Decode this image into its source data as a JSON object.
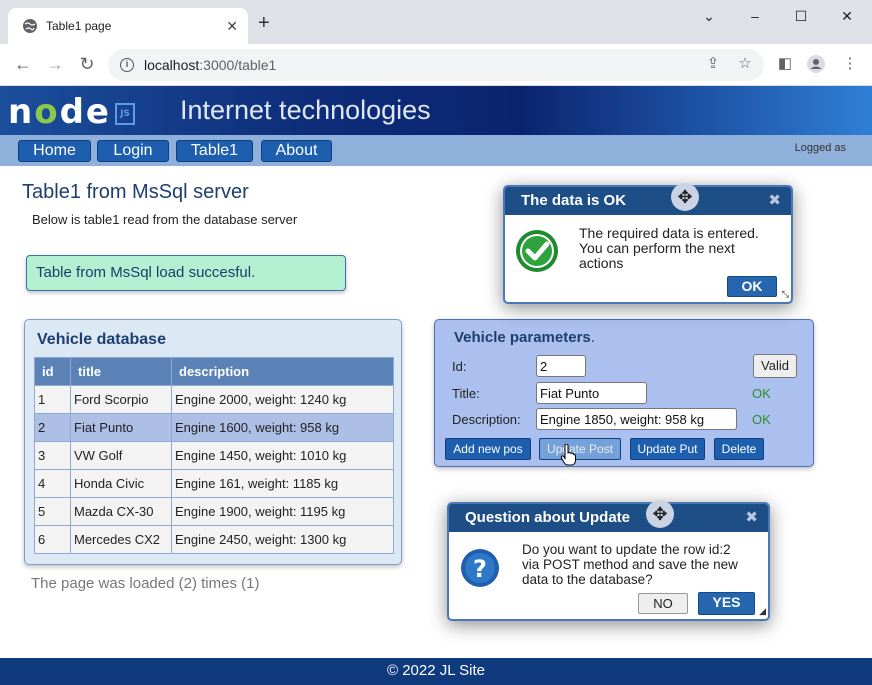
{
  "browser": {
    "tab_title": "Table1 page",
    "tab_close": "✕",
    "new_tab": "+",
    "url_host": "localhost",
    "url_path": ":3000/table1",
    "controls": {
      "minimize": "⌄",
      "restore": "–",
      "maximize": "☐",
      "close": "✕"
    }
  },
  "header": {
    "logo_letters": [
      "n",
      "o",
      "d",
      "e"
    ],
    "logo_js": "JS",
    "title": "Internet technologies"
  },
  "nav": {
    "items": [
      {
        "label": "Home"
      },
      {
        "label": "Login"
      },
      {
        "label": "Table1"
      },
      {
        "label": "About"
      }
    ],
    "logged_as": "Logged as"
  },
  "main": {
    "title": "Table1 from MsSql server",
    "subtitle": "Below is table1 read from the database server",
    "alert": "Table from MsSql load succesful.",
    "load_counter": "The page was loaded (2) times (1)"
  },
  "vehicle_db": {
    "title": "Vehicle database",
    "columns": [
      "id",
      "title",
      "description"
    ],
    "rows": [
      [
        "1",
        "Ford Scorpio",
        "Engine 2000, weight: 1240 kg"
      ],
      [
        "2",
        "Fiat Punto",
        "Engine 1600, weight: 958 kg"
      ],
      [
        "3",
        "VW Golf",
        "Engine 1450, weight: 1010 kg"
      ],
      [
        "4",
        "Honda Civic",
        "Engine 161, weight: 1185 kg"
      ],
      [
        "5",
        "Mazda CX-30",
        "Engine 1900, weight: 1195 kg"
      ],
      [
        "6",
        "Mercedes CX2",
        "Engine 2450, weight: 1300 kg"
      ]
    ],
    "selected_row": "2"
  },
  "params": {
    "title": "Vehicle parameters",
    "title_suffix": ".",
    "id_label": "Id:",
    "id_value": "2",
    "title_label": "Title:",
    "title_value": "Fiat Punto",
    "title_status": "OK",
    "desc_label": "Description:",
    "desc_value": "Engine 1850, weight: 958 kg",
    "desc_status": "OK",
    "valid_button": "Valid",
    "buttons": {
      "add": "Add new pos",
      "update_post": "Update Post",
      "update_put": "Update Put",
      "delete": "Delete"
    }
  },
  "dialog_ok": {
    "title": "The data is OK",
    "close": "✖",
    "message_lines": [
      "The required data is entered.",
      "You can perform the next",
      "actions"
    ],
    "ok_button": "OK"
  },
  "dialog_question": {
    "title": "Question about Update",
    "close": "✖",
    "message_lines": [
      "Do you want to update the row id:2",
      "via POST method and save the new",
      "data to the database?"
    ],
    "no_button": "NO",
    "yes_button": "YES"
  },
  "footer": {
    "text": "© 2022 JL Site"
  },
  "colors": {
    "header_dark": "#0b2470",
    "nav_bg": "#8fb0da",
    "button_blue": "#1d5fae",
    "alert_green": "#b3f0d2",
    "ok_green": "#2e8b2e",
    "footer_bg": "#0f3a7e"
  }
}
